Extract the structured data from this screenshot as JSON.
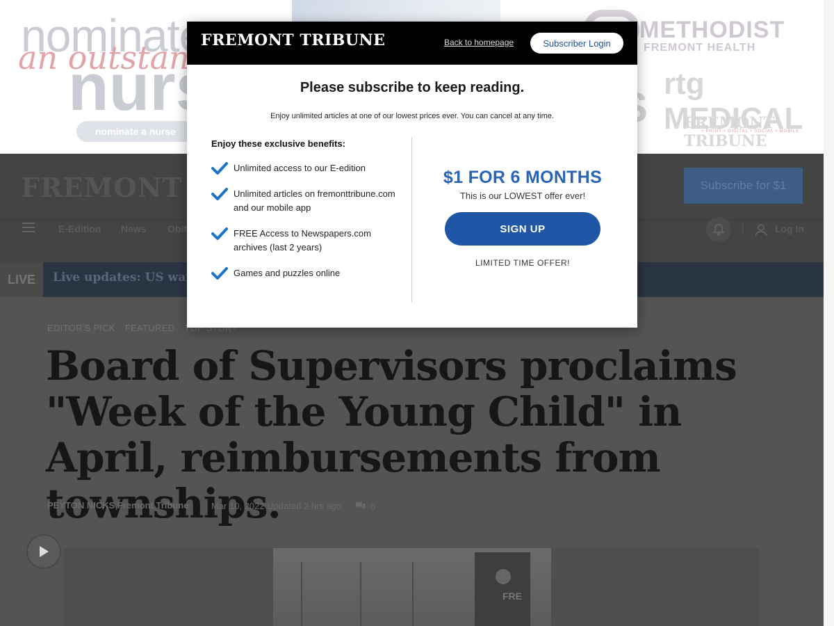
{
  "ad": {
    "line1": "nominate",
    "line2": "an outstanding",
    "line3": "nurse",
    "button": "nominate a nurse",
    "sponsor1_line1": "METHODIST",
    "sponsor1_line2": "FREMONT HEALTH",
    "sponsor2": "rtg MEDICAL",
    "sponsor3": "FREMONT TRIBUNE",
    "sponsor3_sub": "• PRINT • DIGITAL • SOCIAL • MOBILE"
  },
  "header": {
    "logo": "FREMONT TRIBUNE",
    "subscribe_cta": "Subscribe for $1",
    "nav": [
      "E-Edition",
      "News",
      "Obit"
    ],
    "login": "Log In"
  },
  "live": {
    "tag": "LIVE",
    "headline": "Live updates: US warns"
  },
  "article": {
    "kickers": [
      "EDITOR'S PICK",
      "FEATURED",
      "TOP STORY"
    ],
    "headline": "Board of Supervisors proclaims \"Week of the Young Child\" in April, reimbursements from townships.",
    "author": "PEYTON NICKS Fremont Tribune",
    "date": "Mar 10, 2022 Updated 2 hrs ago",
    "comment_count": "0",
    "tower_letters": "FRE"
  },
  "modal": {
    "logo": "FREMONT TRIBUNE",
    "back_link": "Back to homepage",
    "subscriber_login": "Subscriber Login",
    "title": "Please subscribe to keep reading.",
    "subtitle": "Enjoy unlimited articles at one of our lowest prices ever. You can cancel at any time.",
    "benefits_title": "Enjoy these exclusive benefits:",
    "benefits": [
      "Unlimited access to our E-edition",
      "Unlimited articles on fremonttribune.com and our mobile app",
      "FREE Access to Newspapers.com archives (last 2 years)",
      "Games and puzzles online"
    ],
    "offer_price": "$1 FOR 6 MONTHS",
    "offer_note": "This is our LOWEST offer ever!",
    "signup": "SIGN UP",
    "limited": "LIMITED TIME OFFER!"
  },
  "colors": {
    "modal_accent": "#2a64b3",
    "signup_button": "#1f56a6",
    "check": "#1a73c9"
  },
  "icons": [
    "menu-icon",
    "bell-icon",
    "user-icon",
    "comment-icon",
    "play-icon",
    "checkmark-icon"
  ]
}
